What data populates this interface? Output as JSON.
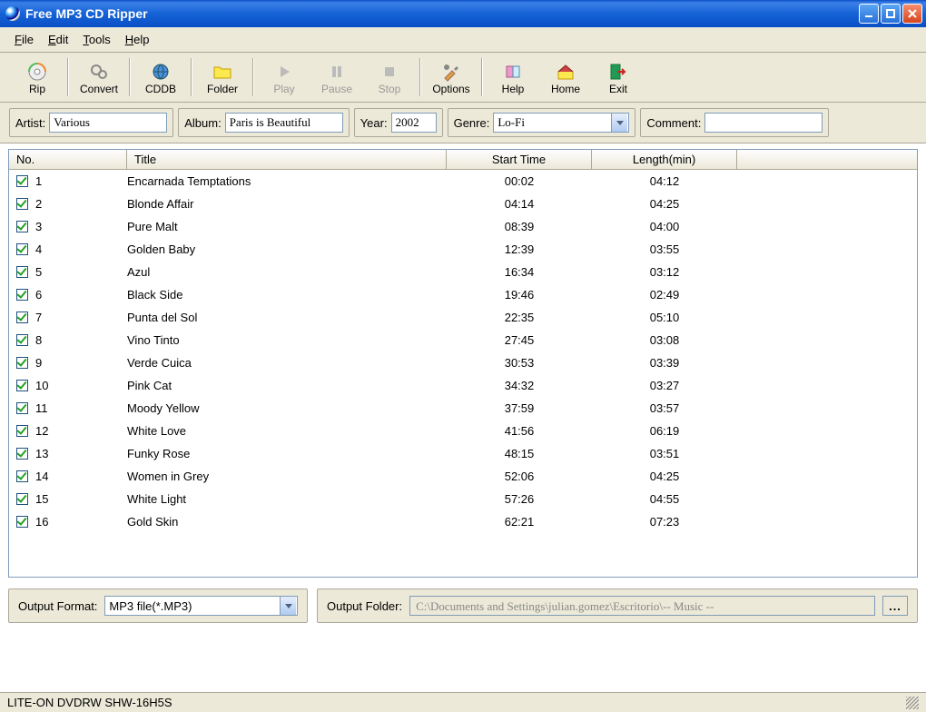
{
  "window": {
    "title": "Free MP3 CD Ripper"
  },
  "menu": {
    "file": "File",
    "file_u": "F",
    "edit": "Edit",
    "edit_u": "E",
    "tools": "Tools",
    "tools_u": "T",
    "help": "Help",
    "help_u": "H"
  },
  "toolbar": {
    "rip": "Rip",
    "convert": "Convert",
    "cddb": "CDDB",
    "folder": "Folder",
    "play": "Play",
    "pause": "Pause",
    "stop": "Stop",
    "options": "Options",
    "help": "Help",
    "home": "Home",
    "exit": "Exit"
  },
  "meta": {
    "artist_label": "Artist:",
    "artist": "Various",
    "album_label": "Album:",
    "album": "Paris is Beautiful",
    "year_label": "Year:",
    "year": "2002",
    "genre_label": "Genre:",
    "genre": "Lo-Fi",
    "comment_label": "Comment:",
    "comment": ""
  },
  "columns": {
    "no": "No.",
    "title": "Title",
    "start": "Start Time",
    "length": "Length(min)"
  },
  "tracks": [
    {
      "no": "1",
      "title": "Encarnada Temptations",
      "start": "00:02",
      "length": "04:12",
      "checked": true
    },
    {
      "no": "2",
      "title": "Blonde Affair",
      "start": "04:14",
      "length": "04:25",
      "checked": true
    },
    {
      "no": "3",
      "title": "Pure Malt",
      "start": "08:39",
      "length": "04:00",
      "checked": true
    },
    {
      "no": "4",
      "title": "Golden Baby",
      "start": "12:39",
      "length": "03:55",
      "checked": true
    },
    {
      "no": "5",
      "title": "Azul",
      "start": "16:34",
      "length": "03:12",
      "checked": true
    },
    {
      "no": "6",
      "title": "Black Side",
      "start": "19:46",
      "length": "02:49",
      "checked": true
    },
    {
      "no": "7",
      "title": "Punta del Sol",
      "start": "22:35",
      "length": "05:10",
      "checked": true
    },
    {
      "no": "8",
      "title": "Vino Tinto",
      "start": "27:45",
      "length": "03:08",
      "checked": true
    },
    {
      "no": "9",
      "title": "Verde Cuica",
      "start": "30:53",
      "length": "03:39",
      "checked": true
    },
    {
      "no": "10",
      "title": "Pink Cat",
      "start": "34:32",
      "length": "03:27",
      "checked": true
    },
    {
      "no": "11",
      "title": "Moody Yellow",
      "start": "37:59",
      "length": "03:57",
      "checked": true
    },
    {
      "no": "12",
      "title": "White Love",
      "start": "41:56",
      "length": "06:19",
      "checked": true
    },
    {
      "no": "13",
      "title": "Funky Rose",
      "start": "48:15",
      "length": "03:51",
      "checked": true
    },
    {
      "no": "14",
      "title": "Women in Grey",
      "start": "52:06",
      "length": "04:25",
      "checked": true
    },
    {
      "no": "15",
      "title": "White Light",
      "start": "57:26",
      "length": "04:55",
      "checked": true
    },
    {
      "no": "16",
      "title": "Gold Skin",
      "start": "62:21",
      "length": "07:23",
      "checked": true
    }
  ],
  "output": {
    "format_label": "Output Format:",
    "format": "MP3 file(*.MP3)",
    "folder_label": "Output Folder:",
    "folder": "C:\\Documents and Settings\\julian.gomez\\Escritorio\\-- Music --",
    "browse": "..."
  },
  "status": "LITE-ON DVDRW SHW-16H5S"
}
